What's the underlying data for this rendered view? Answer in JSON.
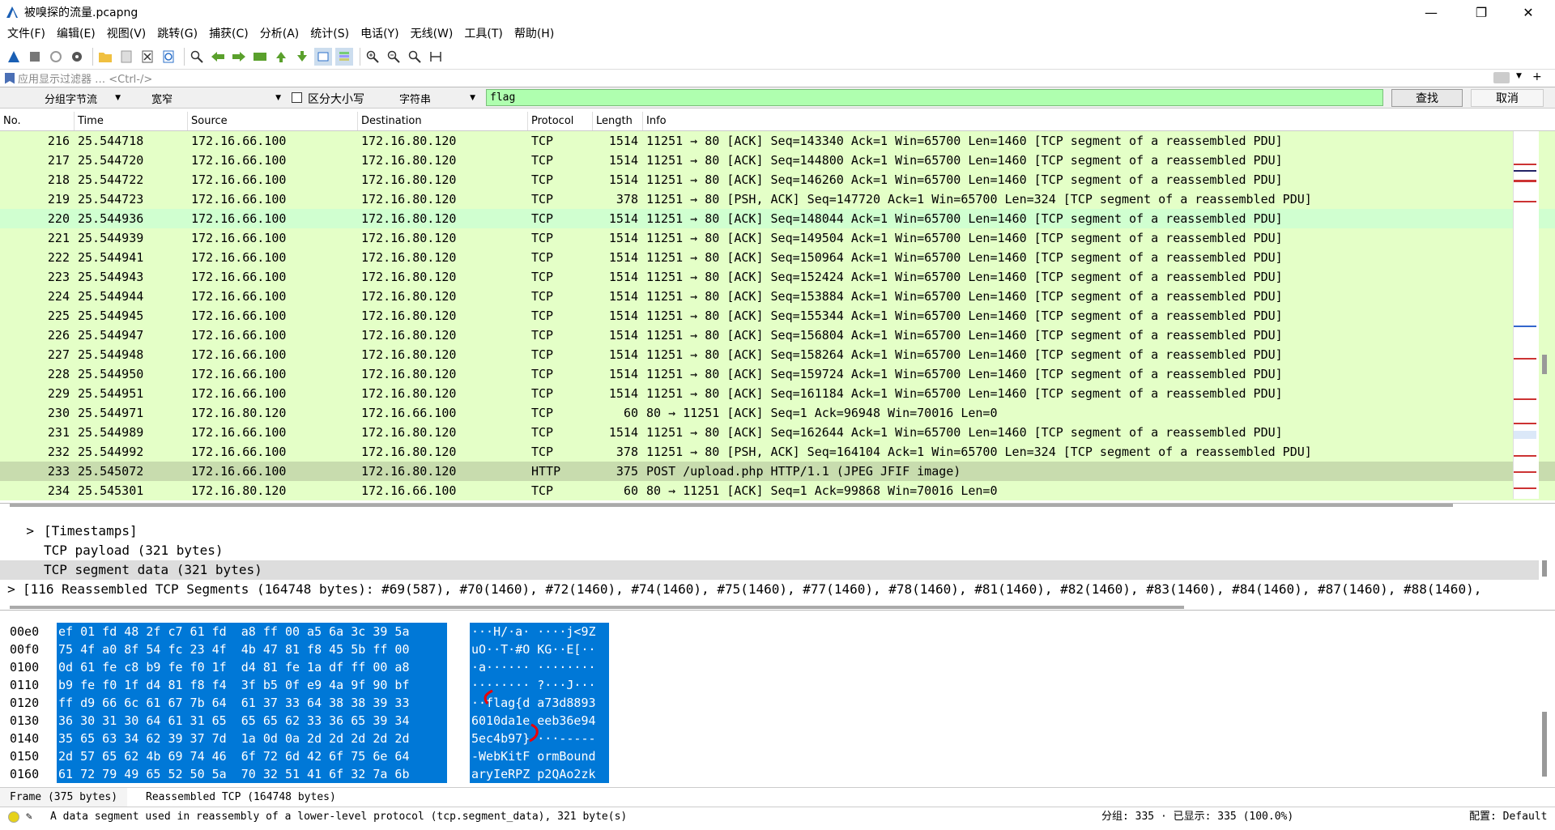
{
  "window": {
    "title": "被嗅探的流量.pcapng"
  },
  "menu": [
    "文件(F)",
    "编辑(E)",
    "视图(V)",
    "跳转(G)",
    "捕获(C)",
    "分析(A)",
    "统计(S)",
    "电话(Y)",
    "无线(W)",
    "工具(T)",
    "帮助(H)"
  ],
  "filter": {
    "placeholder": "应用显示过滤器 … <Ctrl-/>"
  },
  "find": {
    "search_in": "分组字节流",
    "charset": "宽窄",
    "case_label": "区分大小写",
    "type": "字符串",
    "query": "flag",
    "find_button": "查找",
    "cancel_button": "取消"
  },
  "columns": [
    "No.",
    "Time",
    "Source",
    "Destination",
    "Protocol",
    "Length",
    "Info"
  ],
  "packets": [
    {
      "no": "216",
      "time": "25.544718",
      "src": "172.16.66.100",
      "dst": "172.16.80.120",
      "proto": "TCP",
      "len": "1514",
      "info": "11251 → 80 [ACK] Seq=143340 Ack=1 Win=65700 Len=1460 [TCP segment of a reassembled PDU]"
    },
    {
      "no": "217",
      "time": "25.544720",
      "src": "172.16.66.100",
      "dst": "172.16.80.120",
      "proto": "TCP",
      "len": "1514",
      "info": "11251 → 80 [ACK] Seq=144800 Ack=1 Win=65700 Len=1460 [TCP segment of a reassembled PDU]"
    },
    {
      "no": "218",
      "time": "25.544722",
      "src": "172.16.66.100",
      "dst": "172.16.80.120",
      "proto": "TCP",
      "len": "1514",
      "info": "11251 → 80 [ACK] Seq=146260 Ack=1 Win=65700 Len=1460 [TCP segment of a reassembled PDU]"
    },
    {
      "no": "219",
      "time": "25.544723",
      "src": "172.16.66.100",
      "dst": "172.16.80.120",
      "proto": "TCP",
      "len": "378",
      "info": "11251 → 80 [PSH, ACK] Seq=147720 Ack=1 Win=65700 Len=324 [TCP segment of a reassembled PDU]"
    },
    {
      "no": "220",
      "time": "25.544936",
      "src": "172.16.66.100",
      "dst": "172.16.80.120",
      "proto": "TCP",
      "len": "1514",
      "info": "11251 → 80 [ACK] Seq=148044 Ack=1 Win=65700 Len=1460 [TCP segment of a reassembled PDU]"
    },
    {
      "no": "221",
      "time": "25.544939",
      "src": "172.16.66.100",
      "dst": "172.16.80.120",
      "proto": "TCP",
      "len": "1514",
      "info": "11251 → 80 [ACK] Seq=149504 Ack=1 Win=65700 Len=1460 [TCP segment of a reassembled PDU]"
    },
    {
      "no": "222",
      "time": "25.544941",
      "src": "172.16.66.100",
      "dst": "172.16.80.120",
      "proto": "TCP",
      "len": "1514",
      "info": "11251 → 80 [ACK] Seq=150964 Ack=1 Win=65700 Len=1460 [TCP segment of a reassembled PDU]"
    },
    {
      "no": "223",
      "time": "25.544943",
      "src": "172.16.66.100",
      "dst": "172.16.80.120",
      "proto": "TCP",
      "len": "1514",
      "info": "11251 → 80 [ACK] Seq=152424 Ack=1 Win=65700 Len=1460 [TCP segment of a reassembled PDU]"
    },
    {
      "no": "224",
      "time": "25.544944",
      "src": "172.16.66.100",
      "dst": "172.16.80.120",
      "proto": "TCP",
      "len": "1514",
      "info": "11251 → 80 [ACK] Seq=153884 Ack=1 Win=65700 Len=1460 [TCP segment of a reassembled PDU]"
    },
    {
      "no": "225",
      "time": "25.544945",
      "src": "172.16.66.100",
      "dst": "172.16.80.120",
      "proto": "TCP",
      "len": "1514",
      "info": "11251 → 80 [ACK] Seq=155344 Ack=1 Win=65700 Len=1460 [TCP segment of a reassembled PDU]"
    },
    {
      "no": "226",
      "time": "25.544947",
      "src": "172.16.66.100",
      "dst": "172.16.80.120",
      "proto": "TCP",
      "len": "1514",
      "info": "11251 → 80 [ACK] Seq=156804 Ack=1 Win=65700 Len=1460 [TCP segment of a reassembled PDU]"
    },
    {
      "no": "227",
      "time": "25.544948",
      "src": "172.16.66.100",
      "dst": "172.16.80.120",
      "proto": "TCP",
      "len": "1514",
      "info": "11251 → 80 [ACK] Seq=158264 Ack=1 Win=65700 Len=1460 [TCP segment of a reassembled PDU]"
    },
    {
      "no": "228",
      "time": "25.544950",
      "src": "172.16.66.100",
      "dst": "172.16.80.120",
      "proto": "TCP",
      "len": "1514",
      "info": "11251 → 80 [ACK] Seq=159724 Ack=1 Win=65700 Len=1460 [TCP segment of a reassembled PDU]"
    },
    {
      "no": "229",
      "time": "25.544951",
      "src": "172.16.66.100",
      "dst": "172.16.80.120",
      "proto": "TCP",
      "len": "1514",
      "info": "11251 → 80 [ACK] Seq=161184 Ack=1 Win=65700 Len=1460 [TCP segment of a reassembled PDU]"
    },
    {
      "no": "230",
      "time": "25.544971",
      "src": "172.16.80.120",
      "dst": "172.16.66.100",
      "proto": "TCP",
      "len": "60",
      "info": "80 → 11251 [ACK] Seq=1 Ack=96948 Win=70016 Len=0"
    },
    {
      "no": "231",
      "time": "25.544989",
      "src": "172.16.66.100",
      "dst": "172.16.80.120",
      "proto": "TCP",
      "len": "1514",
      "info": "11251 → 80 [ACK] Seq=162644 Ack=1 Win=65700 Len=1460 [TCP segment of a reassembled PDU]"
    },
    {
      "no": "232",
      "time": "25.544992",
      "src": "172.16.66.100",
      "dst": "172.16.80.120",
      "proto": "TCP",
      "len": "378",
      "info": "11251 → 80 [PSH, ACK] Seq=164104 Ack=1 Win=65700 Len=324 [TCP segment of a reassembled PDU]"
    },
    {
      "no": "233",
      "time": "25.545072",
      "src": "172.16.66.100",
      "dst": "172.16.80.120",
      "proto": "HTTP",
      "len": "375",
      "info": "POST /upload.php HTTP/1.1  (JPEG JFIF image)"
    },
    {
      "no": "234",
      "time": "25.545301",
      "src": "172.16.80.120",
      "dst": "172.16.66.100",
      "proto": "TCP",
      "len": "60",
      "info": "80 → 11251 [ACK] Seq=1 Ack=99868 Win=70016 Len=0"
    }
  ],
  "detail": [
    {
      "expander": ">",
      "text": "[Timestamps]"
    },
    {
      "expander": "",
      "text": "TCP payload (321 bytes)"
    },
    {
      "expander": "",
      "text": "TCP segment data (321 bytes)"
    },
    {
      "expander": ">",
      "text": "[116 Reassembled TCP Segments (164748 bytes): #69(587), #70(1460), #72(1460), #74(1460), #75(1460), #77(1460), #78(1460), #81(1460), #82(1460), #83(1460), #84(1460), #87(1460), #88(1460),"
    }
  ],
  "bytes": [
    {
      "off": "00e0",
      "hex": "ef 01 fd 48 2f c7 61 fd  a8 ff 00 a5 6a 3c 39 5a",
      "ascii": "···H/·a· ····j<9Z"
    },
    {
      "off": "00f0",
      "hex": "75 4f a0 8f 54 fc 23 4f  4b 47 81 f8 45 5b ff 00",
      "ascii": "uO··T·#O KG··E[··"
    },
    {
      "off": "0100",
      "hex": "0d 61 fe c8 b9 fe f0 1f  d4 81 fe 1a df ff 00 a8",
      "ascii": "·a······ ········"
    },
    {
      "off": "0110",
      "hex": "b9 fe f0 1f d4 81 f8 f4  3f b5 0f e9 4a 9f 90 bf",
      "ascii": "········ ?···J···"
    },
    {
      "off": "0120",
      "hex": "ff d9 66 6c 61 67 7b 64  61 37 33 64 38 38 39 33",
      "ascii": "··flag{d a73d8893"
    },
    {
      "off": "0130",
      "hex": "36 30 31 30 64 61 31 65  65 65 62 33 36 65 39 34",
      "ascii": "6010da1e eeb36e94"
    },
    {
      "off": "0140",
      "hex": "35 65 63 34 62 39 37 7d  1a 0d 0a 2d 2d 2d 2d 2d",
      "ascii": "5ec4b97} ···-----"
    },
    {
      "off": "0150",
      "hex": "2d 57 65 62 4b 69 74 46  6f 72 6d 42 6f 75 6e 64",
      "ascii": "-WebKitF ormBound"
    },
    {
      "off": "0160",
      "hex": "61 72 79 49 65 52 50 5a  70 32 51 41 6f 32 7a 6b",
      "ascii": "aryIeRPZ p2QAo2zk"
    }
  ],
  "byte_tabs": [
    "Frame (375 bytes)",
    "Reassembled TCP (164748 bytes)"
  ],
  "status": {
    "message": "A data segment used in reassembly of a lower-level protocol (tcp.segment_data), 321 byte(s)",
    "packets": "分组: 335 · 已显示: 335 (100.0%)",
    "profile": "配置: Default"
  },
  "colors": {
    "tcp_row": "#e4ffc7",
    "http_row": "#c8dcae",
    "selection": "#0078d7",
    "find_ok": "#afffaf"
  }
}
